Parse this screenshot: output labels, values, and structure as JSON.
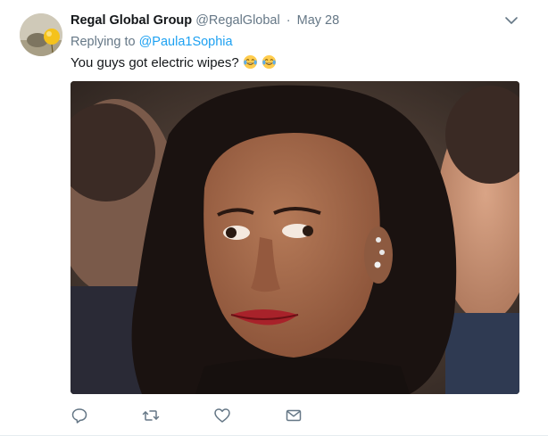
{
  "tweet": {
    "author_name": "Regal Global Group",
    "handle": "@RegalGlobal",
    "separator": "·",
    "date": "May 28",
    "replying_prefix": "Replying to",
    "replying_to": "@Paula1Sophia",
    "text": "You guys got electric wipes?",
    "emojis": [
      "face-with-tears-of-joy",
      "face-with-tears-of-joy"
    ]
  },
  "media": {
    "description_icon": "photo"
  },
  "actions": [
    {
      "icon": "reply-icon"
    },
    {
      "icon": "retweet-icon"
    },
    {
      "icon": "like-icon"
    },
    {
      "icon": "direct-message-icon"
    }
  ],
  "colors": {
    "link": "#1da1f2",
    "secondary_text": "#657786",
    "primary_text": "#14171a",
    "icon": "#657786"
  }
}
